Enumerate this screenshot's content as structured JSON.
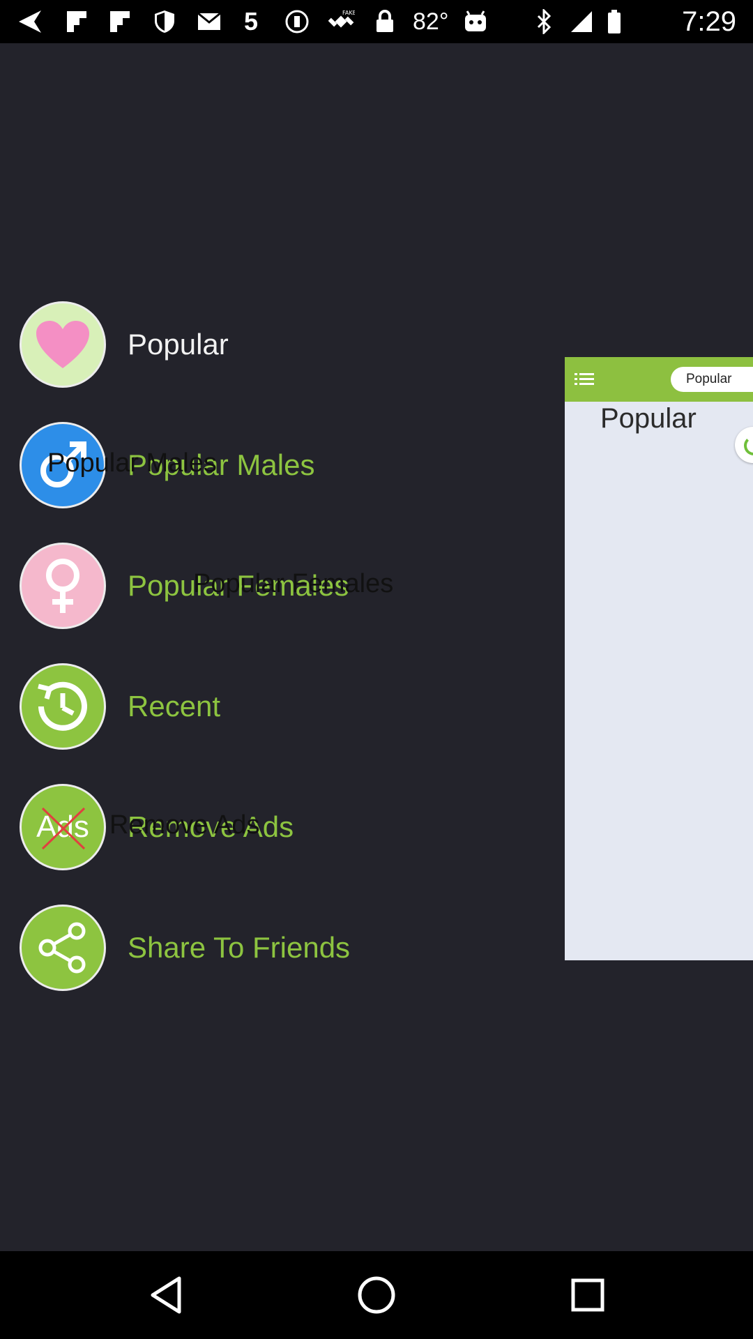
{
  "status_bar": {
    "temperature": "82°",
    "time": "7:29",
    "notification_number": "5"
  },
  "menu": {
    "items": [
      {
        "label": "Popular",
        "icon": "heart-icon",
        "circle_color": "#d8f0b8",
        "label_color": "#f2f2f2"
      },
      {
        "label": "Popular Males",
        "icon": "male-symbol-icon",
        "circle_color": "#2d8ee8",
        "label_color": "#8dc440"
      },
      {
        "label": "Popular Females",
        "icon": "female-symbol-icon",
        "circle_color": "#f5b8cc",
        "label_color": "#8dc440"
      },
      {
        "label": "Recent",
        "icon": "history-clock-icon",
        "circle_color": "#8dc440",
        "label_color": "#8dc440"
      },
      {
        "label": "Remove Ads",
        "icon": "no-ads-icon",
        "icon_text": "Ads",
        "circle_color": "#8dc440",
        "label_color": "#8dc440"
      },
      {
        "label": "Share To Friends",
        "icon": "share-icon",
        "circle_color": "#8dc440",
        "label_color": "#8dc440"
      }
    ],
    "ghost_labels": {
      "males": "Popular Males",
      "females": "Popular Females",
      "remove_ads": "Remove Ads"
    }
  },
  "preview": {
    "tab_label": "Popular",
    "title": "Popular",
    "toolbar_color": "#8dc040"
  }
}
